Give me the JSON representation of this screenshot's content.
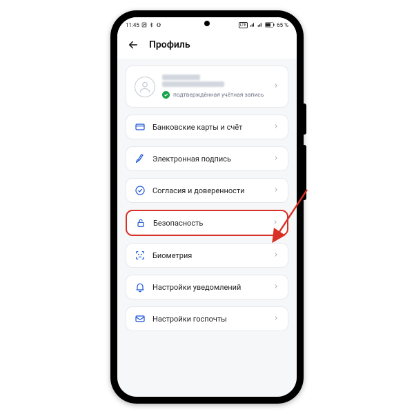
{
  "statusbar": {
    "time": "11:45",
    "battery": "65 %"
  },
  "header": {
    "title": "Профиль"
  },
  "user": {
    "verified_label": "подтверждённая учётная запись"
  },
  "items": [
    {
      "label": "Банковские карты и счёт"
    },
    {
      "label": "Электронная подпись"
    },
    {
      "label": "Согласия и доверенности"
    },
    {
      "label": "Безопасность"
    },
    {
      "label": "Биометрия"
    },
    {
      "label": "Настройки уведомлений"
    },
    {
      "label": "Настройки госпочты"
    }
  ]
}
